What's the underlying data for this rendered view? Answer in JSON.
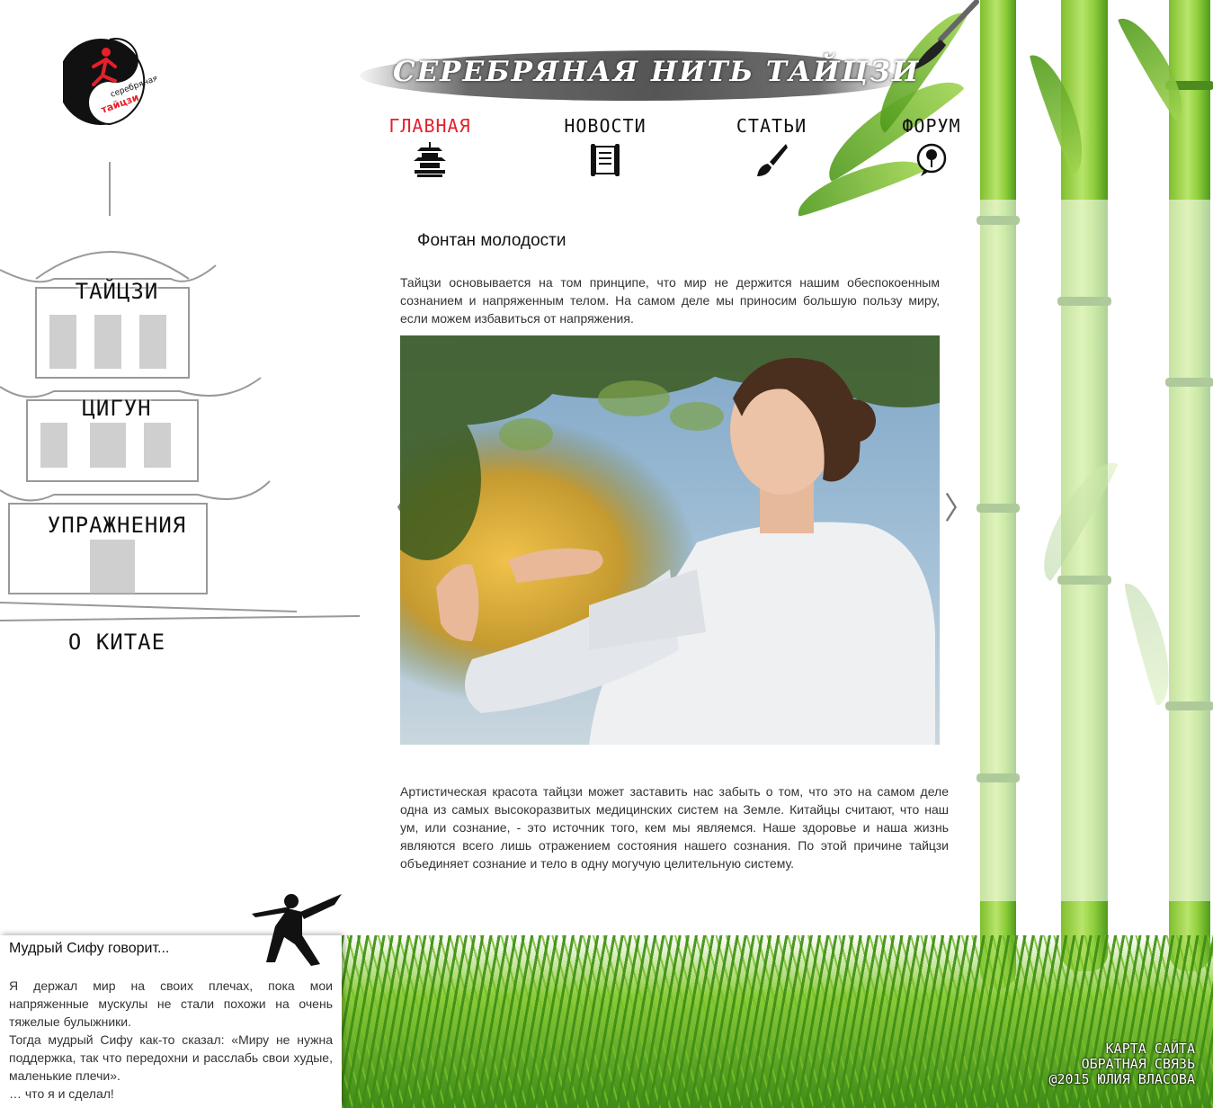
{
  "header": {
    "site_title": "СЕРЕБРЯНАЯ НИТЬ ТАЙЦЗИ",
    "logo_text_top": "серебряная нить",
    "logo_text_bottom": "тайцзи"
  },
  "topnav": [
    {
      "label": "ГЛАВНАЯ",
      "icon": "pagoda-icon",
      "active": true
    },
    {
      "label": "НОВОСТИ",
      "icon": "scroll-icon",
      "active": false
    },
    {
      "label": "СТАТЬИ",
      "icon": "brush-icon",
      "active": false
    },
    {
      "label": "ФОРУМ",
      "icon": "tree-chat-icon",
      "active": false
    }
  ],
  "sidebar": {
    "items": [
      {
        "label": "ТАЙЦЗИ"
      },
      {
        "label": "ЦИГУН"
      },
      {
        "label": "УПРАЖНЕНИЯ"
      },
      {
        "label": "О КИТАЕ"
      }
    ]
  },
  "article": {
    "title": "Фонтан молодости",
    "paragraph1": "Тайцзи основывается на том принципе, что мир не держится нашим обеспокоенным сознанием и напряженным телом. На самом деле мы приносим большую пользу миру, если можем избавиться от напряжения.",
    "paragraph2": "Артистическая красота тайцзи может заставить нас забыть о том, что это на самом деле одна из самых высокоразвитых медицинских систем на Земле. Китайцы считают, что наш ум, или сознание, - это источник того, кем мы являемся. Наше здоровье и наша жизнь являются всего лишь отражением состояния нашего сознания. По этой причине тайцзи объединяет сознание и тело в одну могучую целительную систему.",
    "prev_arrow": "〈",
    "next_arrow": "〉"
  },
  "quote": {
    "title": "Мудрый Сифу говорит...",
    "line1": "Я держал мир на своих плечах, пока мои напряженные мускулы не стали похожи на очень тяжелые булыжники.",
    "line2": "Тогда мудрый Сифу как-то сказал: «Миру не нужна поддержка, так что передохни и расслабь свои худые, маленькие плечи».",
    "line3": "… что я и сделал!"
  },
  "footer": {
    "sitemap": "КАРТА САЙТА",
    "feedback": "ОБРАТНАЯ СВЯЗЬ",
    "copyright": "@2015 ЮЛИЯ ВЛАСОВА"
  },
  "colors": {
    "active_nav": "#e5202b",
    "bamboo": "#8fcf3c",
    "text": "#333333"
  }
}
